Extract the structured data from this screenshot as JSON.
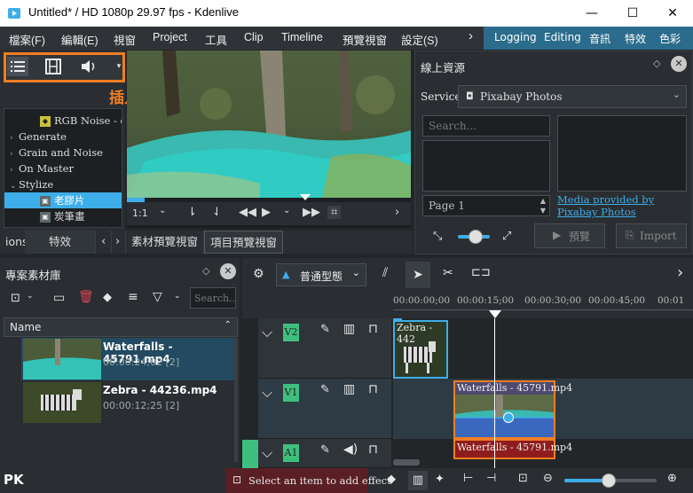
{
  "window": {
    "title": "Untitled* / HD 1080p 29.97 fps - Kdenlive",
    "minimize": "—",
    "maximize": "☐",
    "close": "✕"
  },
  "menu": {
    "items": [
      "檔案(F)",
      "編輯(E)",
      "視窗",
      "Project",
      "工具",
      "Clip",
      "Timeline",
      "預覽視窗",
      "設定(S)"
    ],
    "overflow": "›"
  },
  "layouts": [
    "Logging",
    "Editing",
    "音訊",
    "特效",
    "色彩"
  ],
  "effects": {
    "annotation": "插入特效",
    "tree": [
      {
        "label": "RGB Noise - de",
        "level": 2,
        "icon": true
      },
      {
        "label": "Generate",
        "level": 1,
        "arrow": "›"
      },
      {
        "label": "Grain and Noise",
        "level": 1,
        "arrow": "›"
      },
      {
        "label": "On Master",
        "level": 1,
        "arrow": "›"
      },
      {
        "label": "Stylize",
        "level": 1,
        "arrow": "⌄"
      },
      {
        "label": "老膠片",
        "level": 2,
        "icon": true,
        "selected": true
      },
      {
        "label": "炭筆畫",
        "level": 2,
        "icon": true
      }
    ]
  },
  "monitor": {
    "zoom": "1:1"
  },
  "tabs": {
    "items": [
      "ions",
      "特效",
      "素材預覽視窗",
      "項目預覽視窗"
    ],
    "nav_left": "‹",
    "nav_right": "›"
  },
  "online": {
    "title": "線上資源",
    "service_label": "Service",
    "service_value": "Pixabay Photos",
    "search_placeholder": "Search...",
    "page_value": "Page 1",
    "link_text": "Media provided by Pixabay Photos",
    "preview_button": "預覽",
    "import_button": "Import"
  },
  "bin": {
    "title": "專案素材庫",
    "search_placeholder": "Search...",
    "column_name": "Name",
    "clips": [
      {
        "name": "Waterfalls - 45791.mp4",
        "meta": "00:00:24;02 [2]",
        "selected": true
      },
      {
        "name": "Zebra - 44236.mp4",
        "meta": "00:00:12;25 [2]",
        "selected": false
      }
    ]
  },
  "timeline": {
    "mode": "普通型態",
    "ruler": [
      "00:00:00;00",
      "00:00:15;00",
      "00:00:30;00",
      "00:00:45;00",
      "00:01"
    ],
    "tracks": [
      {
        "name": "V2"
      },
      {
        "name": "V1"
      },
      {
        "name": "A1"
      }
    ],
    "clips": {
      "v2": "Zebra - 442",
      "v1": "Waterfalls - 45791.mp4",
      "a1": "Waterfalls - 45791.mp4"
    }
  },
  "status": {
    "message": "Select an item to add effect"
  },
  "watermark": "PK"
}
